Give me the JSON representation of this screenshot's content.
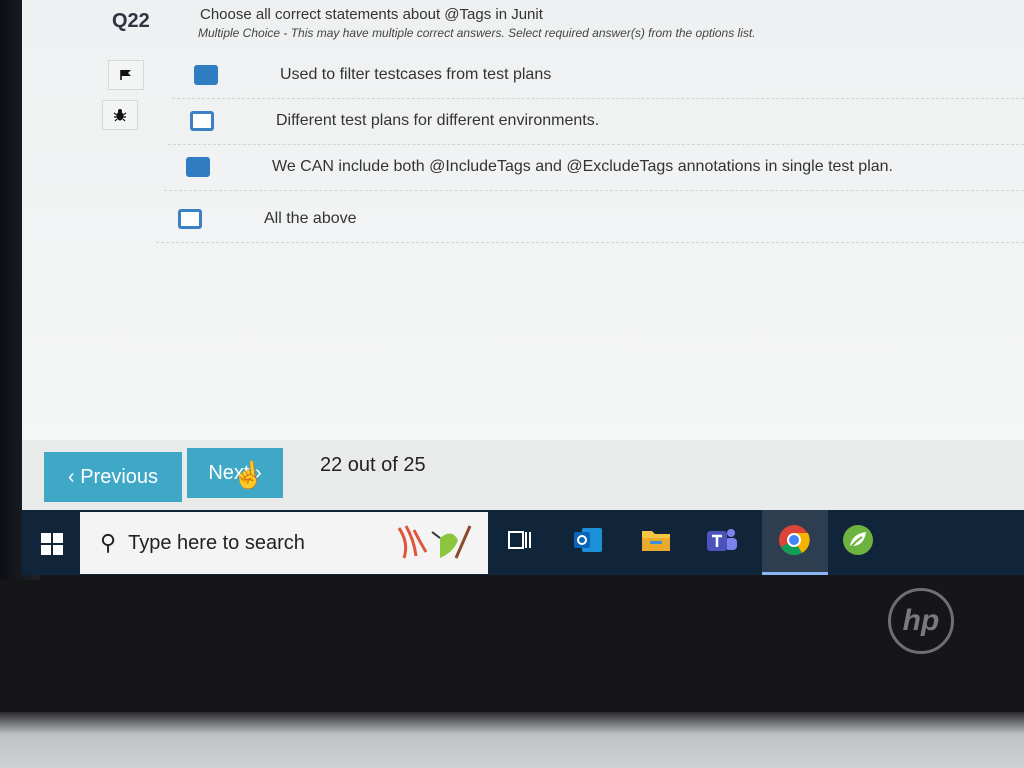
{
  "question": {
    "number": "Q22",
    "title": "Choose all correct statements about @Tags in Junit",
    "subtitle": "Multiple Choice - This may have multiple correct answers. Select required answer(s) from the options list.",
    "options": [
      {
        "label": "Used to filter testcases from test plans",
        "checked": true
      },
      {
        "label": "Different test plans for different environments.",
        "checked": false
      },
      {
        "label": "We CAN include both @IncludeTags and @ExcludeTags annotations in single test plan.",
        "checked": true
      },
      {
        "label": "All the above",
        "checked": false
      }
    ]
  },
  "side_tools": {
    "flag_icon": "flag-icon",
    "bug_icon": "bug-icon"
  },
  "navigation": {
    "previous_label": "‹ Previous",
    "next_label": "Next ›",
    "progress_text": "22 out of 25"
  },
  "taskbar": {
    "search_placeholder": "Type here to search",
    "apps": [
      "task-view-icon",
      "outlook-icon",
      "file-explorer-icon",
      "teams-icon",
      "chrome-icon",
      "spring-tool-suite-icon"
    ],
    "active_app": "chrome-icon"
  },
  "device": {
    "brand": "hp"
  },
  "colors": {
    "accent": "#3fa8c6",
    "checkbox": "#2f7cc1",
    "taskbar": "#10243a"
  }
}
